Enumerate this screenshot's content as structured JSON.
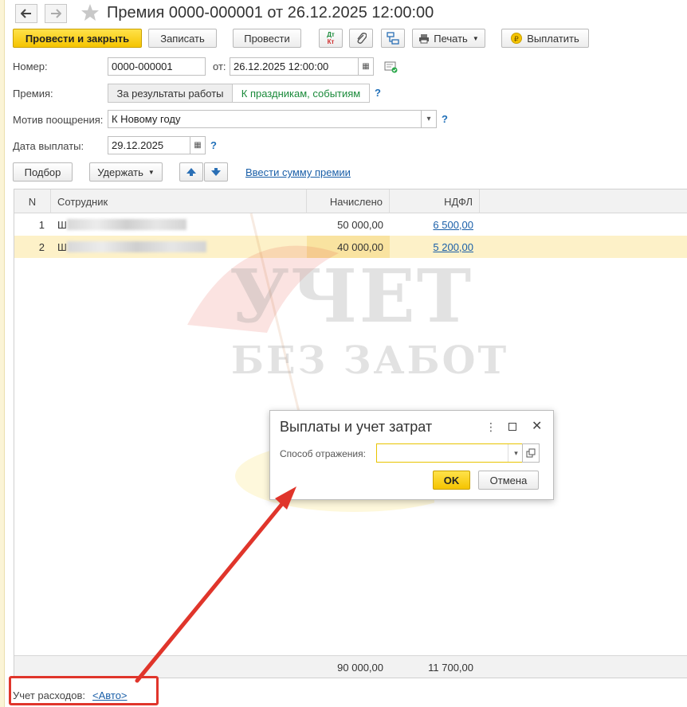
{
  "window": {
    "title": "Премия 0000-000001 от 26.12.2025 12:00:00"
  },
  "toolbar": {
    "post_and_close": "Провести и закрыть",
    "save": "Записать",
    "post": "Провести",
    "dt_kt_top": "Дт",
    "dt_kt_bottom": "Кт",
    "print": "Печать",
    "pay": "Выплатить"
  },
  "form": {
    "number_label": "Номер:",
    "number_value": "0000-000001",
    "date_label": "от:",
    "date_value": "26.12.2025 12:00:00",
    "bonus_label": "Премия:",
    "bonus_options": [
      "За результаты работы",
      "К праздникам, событиям"
    ],
    "bonus_selected": "К праздникам, событиям",
    "motive_label": "Мотив поощрения:",
    "motive_value": "К Новому году",
    "pay_date_label": "Дата выплаты:",
    "pay_date_value": "29.12.2025",
    "help": "?"
  },
  "table_toolbar": {
    "select": "Подбор",
    "withhold": "Удержать",
    "enter_sum": "Ввести сумму премии"
  },
  "table": {
    "columns": [
      "N",
      "Сотрудник",
      "Начислено",
      "НДФЛ"
    ],
    "rows": [
      {
        "n": "1",
        "employee": "Ш",
        "accrued": "50 000,00",
        "ndfl": "6 500,00"
      },
      {
        "n": "2",
        "employee": "Ш",
        "accrued": "40 000,00",
        "ndfl": "5 200,00"
      }
    ],
    "totals": {
      "accrued": "90 000,00",
      "ndfl": "11 700,00"
    }
  },
  "footer": {
    "expense_label": "Учет расходов:",
    "expense_link": "<Авто>"
  },
  "dialog": {
    "title": "Выплаты и учет затрат",
    "method_label": "Способ отражения:",
    "method_value": "",
    "ok": "OK",
    "cancel": "Отмена"
  },
  "watermark": {
    "line1": "УЧЕТ",
    "line2": "БЕЗ ЗАБОТ"
  },
  "colors": {
    "accent_yellow": "#f5c400",
    "selected_row": "#fdf1c8",
    "link_blue": "#1a5fa8",
    "annotation_red": "#e0352b",
    "selected_toggle_text": "#1a8a3a"
  }
}
